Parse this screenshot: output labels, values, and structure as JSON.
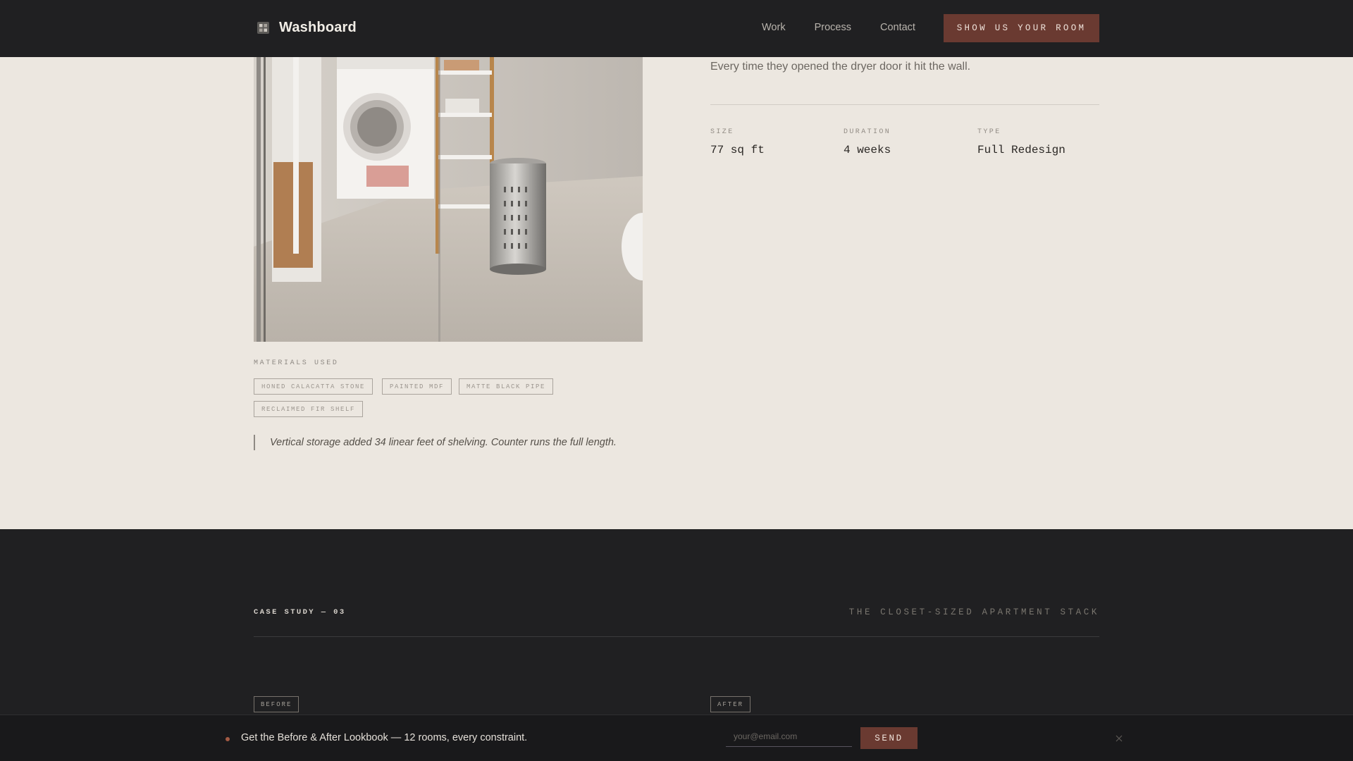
{
  "header": {
    "brand": "Washboard",
    "nav": [
      "Work",
      "Process",
      "Contact"
    ],
    "cta": "SHOW US YOUR ROOM",
    "brand_icon": "grid-logo-icon"
  },
  "case_study_02": {
    "photo": "laundry-room-after-photo",
    "materials_label": "MATERIALS USED",
    "materials": [
      "HONED CALACATTA STONE",
      "PAINTED MDF",
      "MATTE BLACK PIPE",
      "RECLAIMED FIR SHELF"
    ],
    "quote": "Vertical storage added 34 linear feet of shelving. Counter runs the full length.",
    "story": "Every time they opened the dryer door it hit the wall.",
    "specs": [
      {
        "label": "SIZE",
        "value": "77 sq ft"
      },
      {
        "label": "DURATION",
        "value": "4 weeks"
      },
      {
        "label": "TYPE",
        "value": "Full Redesign"
      }
    ]
  },
  "case_study_03": {
    "number": "CASE STUDY — 03",
    "title": "THE CLOSET-SIZED APARTMENT STACK",
    "before": "BEFORE",
    "after": "AFTER"
  },
  "lookbook": {
    "text": "Get the Before & After Lookbook — 12 rooms, every constraint.",
    "placeholder": "your@email.com",
    "send": "SEND"
  },
  "colors": {
    "accent": "#6a3a31",
    "dark_bg": "#202022",
    "light_bg": "#ece7e0"
  }
}
